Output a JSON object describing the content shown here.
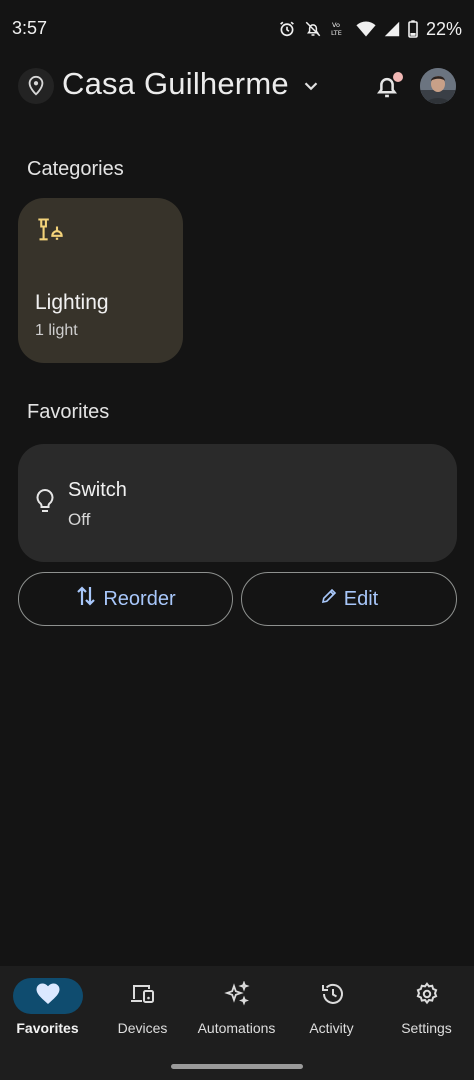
{
  "status_bar": {
    "time": "3:57",
    "battery": "22%",
    "icons": [
      "alarm-icon",
      "notifications-off-icon",
      "volte-icon",
      "wifi-icon",
      "signal-icon",
      "battery-icon"
    ]
  },
  "header": {
    "home_name": "Casa Guilherme",
    "has_notification": true
  },
  "categories": {
    "title": "Categories",
    "items": [
      {
        "label": "Lighting",
        "sub": "1 light",
        "icon": "lamp-icon"
      }
    ]
  },
  "favorites": {
    "title": "Favorites",
    "items": [
      {
        "label": "Switch",
        "sub": "Off",
        "icon": "lightbulb-icon"
      }
    ]
  },
  "actions": {
    "reorder_label": "Reorder",
    "edit_label": "Edit"
  },
  "bottom_nav": {
    "items": [
      {
        "label": "Favorites",
        "icon": "heart-icon",
        "active": true
      },
      {
        "label": "Devices",
        "icon": "devices-icon",
        "active": false
      },
      {
        "label": "Automations",
        "icon": "sparkle-icon",
        "active": false
      },
      {
        "label": "Activity",
        "icon": "history-icon",
        "active": false
      },
      {
        "label": "Settings",
        "icon": "gear-icon",
        "active": false
      }
    ]
  },
  "colors": {
    "background": "#141414",
    "category_card": "#37332a",
    "favorite_card": "#2a2a2a",
    "accent_text": "#a8c7fa",
    "nav_active_pill": "#0f4c6f",
    "lamp_icon": "#f3d37a"
  }
}
